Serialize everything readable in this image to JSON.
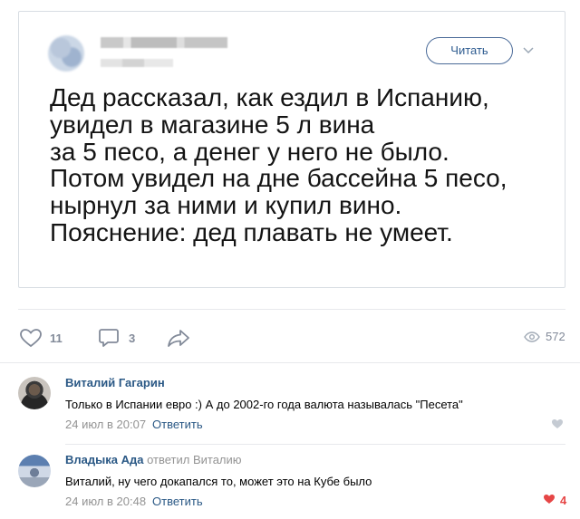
{
  "tweet": {
    "follow_label": "Читать",
    "lines": [
      "Дед рассказал, как ездил в Испанию,",
      "увидел в магазине 5 л вина",
      "за 5 песо, а денег у него не было.",
      "Потом увидел на дне бассейна 5 песо,",
      "нырнул за ними и купил вино.",
      "Пояснение: дед плавать не умеет."
    ]
  },
  "actions": {
    "likes": "11",
    "comments": "3",
    "views": "572"
  },
  "comments": [
    {
      "author": "Виталий Гагарин",
      "text": "Только в Испании евро :) А до 2002-го года валюта называлась \"Песета\"",
      "time": "24 июл в 20:07",
      "reply_label": "Ответить"
    },
    {
      "author": "Владыка Ада",
      "reply_to": "ответил Виталию",
      "text": "Виталий, ну чего докапался то, может это на Кубе было",
      "time": "24 июл в 20:48",
      "reply_label": "Ответить",
      "likes": "4"
    }
  ],
  "colors": {
    "link": "#2a5885",
    "muted": "#828a99",
    "like_red": "#e64646"
  }
}
